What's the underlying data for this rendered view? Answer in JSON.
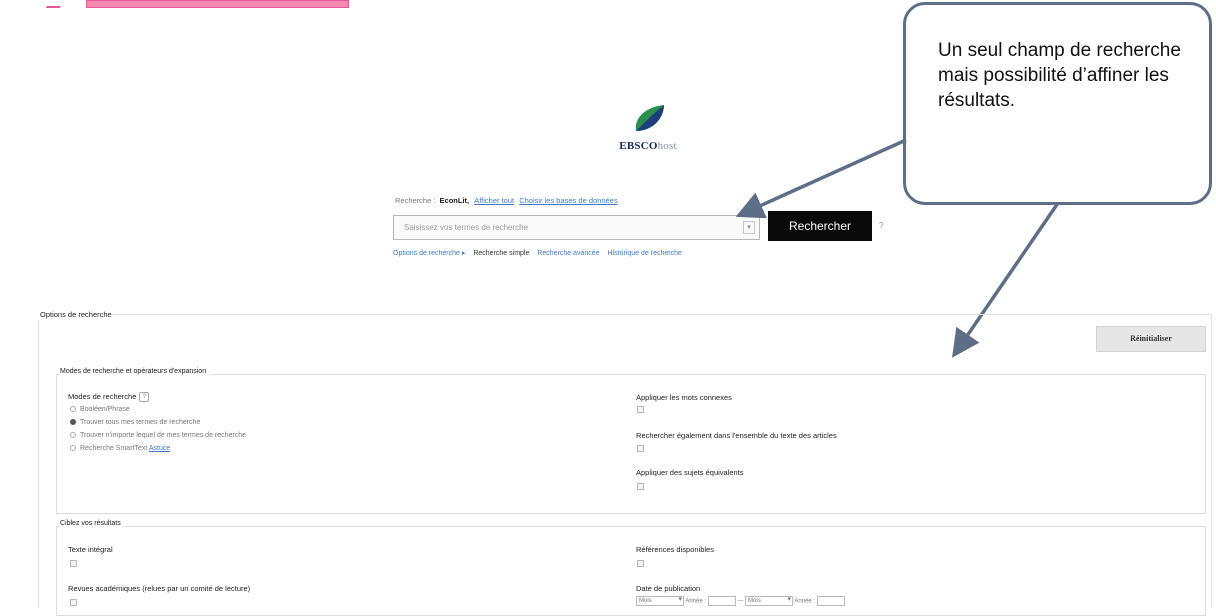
{
  "callout": {
    "text": "Un seul champ de recherche mais possibilité d’affiner les résultats."
  },
  "logo": {
    "brand": "EBSCO",
    "suffix": "host"
  },
  "search": {
    "label": "Recherche :",
    "database": "EconLit,",
    "show_all": "Afficher tout",
    "choose_db": "Choisir les bases de données",
    "placeholder": "Saisissez vos termes de recherche",
    "button": "Rechercher",
    "help": "?"
  },
  "subnav": {
    "options": "Options de recherche ▸",
    "simple": "Recherche simple",
    "advanced": "Recherche avancée",
    "history": "Historique de recherche"
  },
  "panel": {
    "title": "Options de recherche",
    "reset": "Réinitialiser",
    "modes_group": "Modes de recherche et opérateurs d'expansion",
    "modes_title": "Modes de recherche",
    "modes": [
      {
        "label": "Booléen/Phrase",
        "selected": false
      },
      {
        "label": "Trouver tous mes termes de recherche",
        "selected": true
      },
      {
        "label": "Trouver n'importe lequel de mes termes de recherche",
        "selected": false
      },
      {
        "label": "Recherche SmartText",
        "selected": false
      }
    ],
    "smarttext_hint": "Astuce",
    "related_words": "Appliquer les mots connexes",
    "full_text_also": "Rechercher également dans l'ensemble du texte des articles",
    "equivalent_subjects": "Appliquer des sujets équivalents",
    "refine_group": "Ciblez vos résultats",
    "full_text": "Texte intégral",
    "peer_reviewed": "Revues académiques (relues par un comité de lecture)",
    "references": "Références disponibles",
    "pub_date": "Date de publication",
    "month_label": "Mois",
    "year_label": "Année :",
    "dash": "—"
  }
}
